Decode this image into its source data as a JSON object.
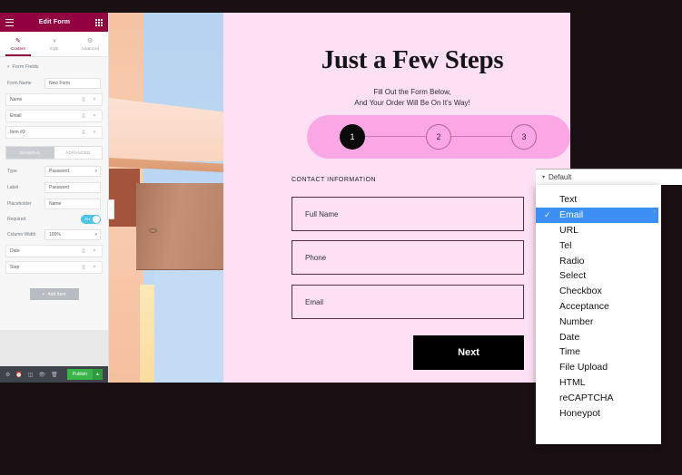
{
  "panel": {
    "header": {
      "title": "Edit Form",
      "menu_icon": "hamburger-icon",
      "grid_icon": "grid-icon"
    },
    "tabs": [
      {
        "label": "Content",
        "icon": "pencil-icon",
        "active": true
      },
      {
        "label": "Style",
        "icon": "contrast-icon",
        "active": false
      },
      {
        "label": "Advanced",
        "icon": "gear-icon",
        "active": false
      }
    ],
    "section_title": "Form Fields",
    "form_name_label": "Form Name",
    "form_name_value": "New Form",
    "fields": [
      {
        "name": "Name"
      },
      {
        "name": "Email"
      },
      {
        "name": "Item #3"
      }
    ],
    "subtabs": [
      {
        "label": "GENERAL",
        "active": true
      },
      {
        "label": "ADVANCED",
        "active": false
      }
    ],
    "settings": [
      {
        "label": "Type",
        "value": "Password",
        "control": "select"
      },
      {
        "label": "Label",
        "value": "Password",
        "control": "text"
      },
      {
        "label": "Placeholder",
        "value": "Name",
        "control": "text"
      }
    ],
    "required_label": "Required",
    "required_on": true,
    "required_toggle_text": "ON",
    "column_width_label": "Column Width",
    "column_width_value": "100%",
    "extra_fields": [
      {
        "name": "Date"
      },
      {
        "name": "Step"
      }
    ],
    "add_item_label": "Add Item",
    "footer": {
      "icons": [
        "settings-icon",
        "history-icon",
        "responsive-icon",
        "preview-icon",
        "trash-icon"
      ],
      "publish_label": "Publish",
      "publish_arrow": "▲"
    }
  },
  "canvas": {
    "heading": "Just a Few Steps",
    "subtitle_line1": "Fill Out the Form Below,",
    "subtitle_line2": "And Your Order Will Be On It's Way!",
    "steps": [
      {
        "number": "1",
        "state": "active"
      },
      {
        "number": "2",
        "state": "idle"
      },
      {
        "number": "3",
        "state": "idle"
      }
    ],
    "section_label": "CONTACT INFORMATION",
    "form_fields": [
      {
        "placeholder": "Full Name"
      },
      {
        "placeholder": "Phone"
      },
      {
        "placeholder": "Email"
      }
    ],
    "next_label": "Next"
  },
  "dropdown": {
    "selected_header": "Default",
    "items": [
      {
        "label": "Text",
        "selected": false
      },
      {
        "label": "Email",
        "selected": true
      },
      {
        "label": "URL",
        "selected": false
      },
      {
        "label": "Tel",
        "selected": false
      },
      {
        "label": "Radio",
        "selected": false
      },
      {
        "label": "Select",
        "selected": false
      },
      {
        "label": "Checkbox",
        "selected": false
      },
      {
        "label": "Acceptance",
        "selected": false
      },
      {
        "label": "Number",
        "selected": false
      },
      {
        "label": "Date",
        "selected": false
      },
      {
        "label": "Time",
        "selected": false
      },
      {
        "label": "File Upload",
        "selected": false
      },
      {
        "label": "HTML",
        "selected": false
      },
      {
        "label": "reCAPTCHA",
        "selected": false
      },
      {
        "label": "Honeypot",
        "selected": false
      }
    ],
    "check_glyph": "✓",
    "highlight_color": "#3b8ff5"
  },
  "colors": {
    "brand": "#93003f",
    "page_pink": "#fde0f4",
    "stepper_pink": "#fba7e6",
    "publish_green": "#39b54a"
  }
}
